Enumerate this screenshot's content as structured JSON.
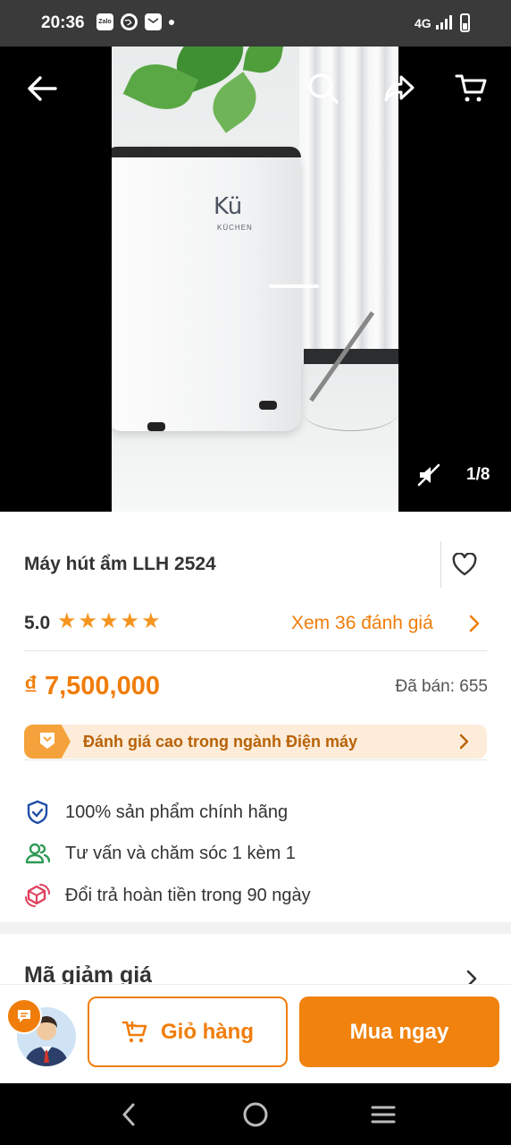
{
  "status_bar": {
    "time": "20:36",
    "network": "4G",
    "notification_icons": [
      "zalo-icon",
      "globe-icon",
      "mail-icon",
      "dot-icon"
    ],
    "zalo_label": "Zalo"
  },
  "hero": {
    "image_counter": "1/8",
    "brand_logo": "Kü",
    "brand_sub": "KÜCHEN",
    "icons": [
      "back-arrow-icon",
      "search-icon",
      "share-icon",
      "cart-icon",
      "mute-icon"
    ]
  },
  "product": {
    "title": "Máy hút ẩm LLH 2524",
    "rating": "5.0",
    "stars": 5,
    "reviews_link": "Xem 36 đánh giá",
    "price": "₫ 7,500,000",
    "sold_label": "Đã bán:",
    "sold_value": "655",
    "banner_text": "Đánh giá cao trong ngành Điện máy"
  },
  "features": [
    {
      "icon": "shield-check-icon",
      "text": "100% sản phẩm chính hãng"
    },
    {
      "icon": "users-icon",
      "text": "Tư vấn và chăm sóc 1 kèm 1"
    },
    {
      "icon": "return-box-icon",
      "text": "Đổi trả hoàn tiền trong 90 ngày"
    }
  ],
  "voucher": {
    "title": "Mã giảm giá"
  },
  "action_bar": {
    "cart_label": "Giỏ hàng",
    "buy_label": "Mua ngay"
  },
  "colors": {
    "accent": "#f07d0a",
    "star": "#f5951f",
    "banner_bg": "#fdecd9",
    "status_bar": "#3a3a3a"
  }
}
